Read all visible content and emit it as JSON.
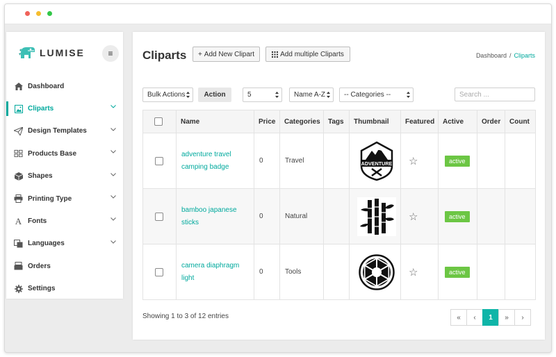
{
  "brand": {
    "name": "LUMISE"
  },
  "sidebar": {
    "items": [
      {
        "label": "Dashboard",
        "icon": "home-icon",
        "has_children": false
      },
      {
        "label": "Cliparts",
        "icon": "image-icon",
        "has_children": true,
        "active": true
      },
      {
        "label": "Design Templates",
        "icon": "paper-plane-icon",
        "has_children": true
      },
      {
        "label": "Products Base",
        "icon": "products-icon",
        "has_children": true
      },
      {
        "label": "Shapes",
        "icon": "cube-icon",
        "has_children": true
      },
      {
        "label": "Printing Type",
        "icon": "printer-icon",
        "has_children": true
      },
      {
        "label": "Fonts",
        "icon": "font-icon",
        "has_children": true
      },
      {
        "label": "Languages",
        "icon": "language-icon",
        "has_children": true
      },
      {
        "label": "Orders",
        "icon": "orders-icon",
        "has_children": false
      },
      {
        "label": "Settings",
        "icon": "gear-icon",
        "has_children": false
      }
    ]
  },
  "header": {
    "title": "Cliparts",
    "add_new": "Add New Clipart",
    "add_multiple": "Add multiple Cliparts",
    "breadcrumb_home": "Dashboard",
    "breadcrumb_sep": "/",
    "breadcrumb_current": "Cliparts"
  },
  "toolbar": {
    "bulk_actions": "Bulk Actions",
    "action": "Action",
    "per_page": "5",
    "sort": "Name A-Z",
    "category": "-- Categories --",
    "search_placeholder": "Search ..."
  },
  "table": {
    "columns": [
      "Name",
      "Price",
      "Categories",
      "Tags",
      "Thumbnail",
      "Featured",
      "Active",
      "Order",
      "Count"
    ],
    "rows": [
      {
        "name": "adventure travel camping badge",
        "price": "0",
        "category": "Travel",
        "tags": "",
        "thumbnail": "adventure-badge",
        "badge_text": "ADVENTURE",
        "active": "active",
        "order": "",
        "count": ""
      },
      {
        "name": "bamboo japanese sticks",
        "price": "0",
        "category": "Natural",
        "tags": "",
        "thumbnail": "bamboo",
        "active": "active",
        "order": "",
        "count": ""
      },
      {
        "name": "camera diaphragm light",
        "price": "0",
        "category": "Tools",
        "tags": "",
        "thumbnail": "aperture",
        "active": "active",
        "order": "",
        "count": ""
      }
    ]
  },
  "footer": {
    "entries": "Showing 1 to 3 of 12 entries",
    "pages": {
      "first": "«",
      "prev": "‹",
      "current": "1",
      "next": "»",
      "last": "›"
    }
  },
  "colors": {
    "accent": "#00a99d",
    "active_badge": "#6cc644",
    "page_active": "#0fb5a8"
  }
}
